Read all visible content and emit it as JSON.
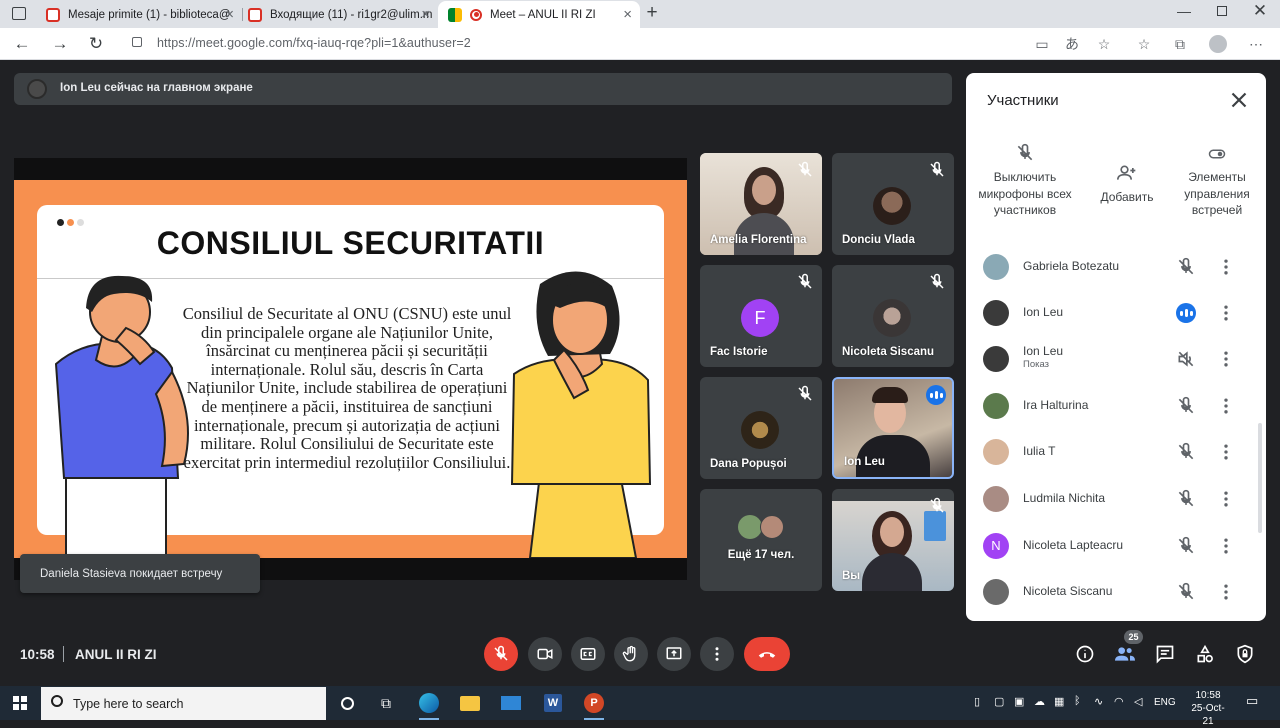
{
  "browser": {
    "tabs": [
      {
        "title": "Mesaje primite (1) - biblioteca@",
        "favicon_color": "#d93025",
        "active": false
      },
      {
        "title": "Входящие (11) - ri1gr2@ulim.m",
        "favicon_color": "#d93025",
        "active": false
      },
      {
        "title": "Meet – ANUL II RI ZI",
        "favicon_color": "#00832d",
        "active": true
      }
    ],
    "new_tab_label": "+",
    "url": "https://meet.google.com/fxq-iauq-rqe?pli=1&authuser=2"
  },
  "meet": {
    "presenting_text": "Ion Leu сейчас на главном экране",
    "slide": {
      "title": "CONSILIUL SECURITATII",
      "body": "Consiliul de Securitate al ONU (CSNU) este unul din principalele organe ale Națiunilor Unite, însărcinat cu menținerea păcii și securității internaționale. Rolul său, descris în Carta Națiunilor Unite, include stabilirea de operațiuni de menținere a păcii, instituirea de sancțiuni internaționale, precum și autorizația de acțiuni militare. Rolul Consiliului de Securitate este exercitat prin intermediul rezoluțiilor Consiliului."
    },
    "tiles": [
      {
        "name": "Amelia Florentina",
        "muted": true
      },
      {
        "name": "Donciu Vlada",
        "muted": true
      },
      {
        "name": "Fac Istorie",
        "muted": true,
        "initial": "F"
      },
      {
        "name": "Nicoleta Siscanu",
        "muted": true
      },
      {
        "name": "Dana Popușoi",
        "muted": true
      },
      {
        "name": "Ion Leu",
        "muted": false,
        "speaking": true
      },
      {
        "name": "Ещё 17 чел.",
        "muted": false
      },
      {
        "name": "Вы",
        "muted": true
      }
    ],
    "toast": "Daniela Stasieva покидает встречу",
    "time": "10:58",
    "meeting_name": "ANUL II RI ZI",
    "participant_count": "25"
  },
  "panel": {
    "title": "Участники",
    "actions": [
      {
        "label": "Выключить микрофоны всех участников",
        "icon": "mic-off-icon"
      },
      {
        "label": "Добавить",
        "icon": "add-person-icon"
      },
      {
        "label": "Элементы управления встречей",
        "icon": "toggle-icon"
      }
    ],
    "participants": [
      {
        "name": "",
        "sub": "",
        "status": "muted"
      },
      {
        "name": "Gabriela Botezatu",
        "sub": "",
        "status": "muted"
      },
      {
        "name": "Ion Leu",
        "sub": "",
        "status": "speaking"
      },
      {
        "name": "Ion Leu",
        "sub": "Показ",
        "status": "audio-off"
      },
      {
        "name": "Ira Halturina",
        "sub": "",
        "status": "muted"
      },
      {
        "name": "Iulia T",
        "sub": "",
        "status": "muted"
      },
      {
        "name": "Ludmila Nichita",
        "sub": "",
        "status": "muted"
      },
      {
        "name": "Nicoleta Lapteacru",
        "sub": "",
        "status": "muted",
        "initial": "N"
      },
      {
        "name": "Nicoleta Siscanu",
        "sub": "",
        "status": "muted"
      }
    ]
  },
  "taskbar": {
    "search_placeholder": "Type here to search",
    "language": "ENG",
    "time": "10:58",
    "date": "25-Oct-21"
  }
}
